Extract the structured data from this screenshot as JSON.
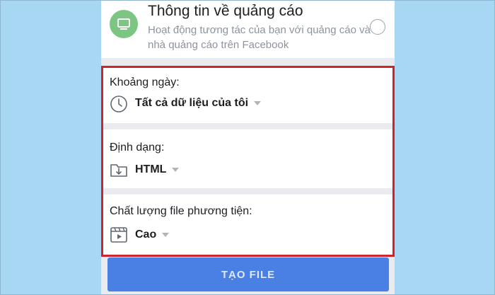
{
  "ad_info": {
    "title": "Thông tin về quảng cáo",
    "description": "Hoạt động tương tác của bạn với quảng cáo và nhà quảng cáo trên Facebook",
    "icon": "monitor-icon",
    "icon_color": "#7cc583"
  },
  "date_range": {
    "label": "Khoảng ngày:",
    "value": "Tất cả dữ liệu của tôi",
    "icon": "clock-icon"
  },
  "format": {
    "label": "Định dạng:",
    "value": "HTML",
    "icon": "folder-download-icon"
  },
  "media_quality": {
    "label": "Chất lượng file phương tiện:",
    "value": "Cao",
    "icon": "video-icon"
  },
  "create_button": {
    "label": "TẠO FILE",
    "color": "#4a7fe3"
  },
  "colors": {
    "background": "#a7d7f3",
    "highlight": "#d0242b"
  }
}
